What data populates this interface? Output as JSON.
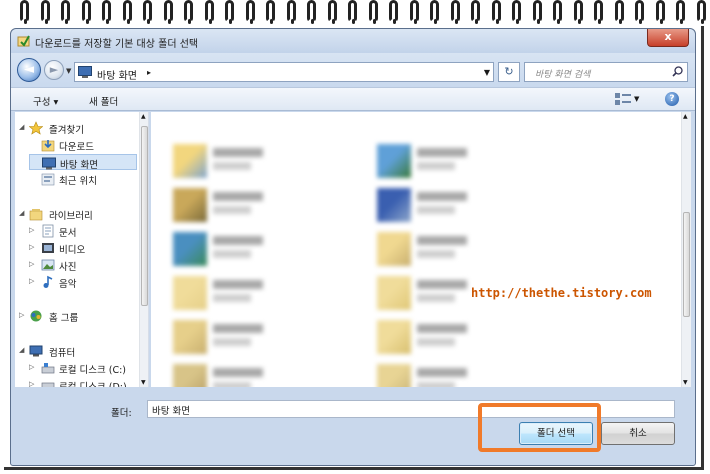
{
  "dialog": {
    "title": "다운로드를 저장할 기본 대상 폴더 선택",
    "close_label": "x"
  },
  "navbar": {
    "back_label": "◄",
    "forward_label": "►",
    "address_crumb": "바탕 화면",
    "address_arrow": "▸",
    "search_placeholder": "바탕 화면 검색"
  },
  "toolbar": {
    "organize_label": "구성 ▾",
    "new_folder_label": "새 폴더",
    "help_label": "?"
  },
  "sidebar": {
    "favorites": {
      "label": "즐겨찾기",
      "items": [
        {
          "label": "다운로드"
        },
        {
          "label": "바탕 화면"
        },
        {
          "label": "최근 위치"
        }
      ]
    },
    "libraries": {
      "label": "라이브러리",
      "items": [
        {
          "label": "문서"
        },
        {
          "label": "비디오"
        },
        {
          "label": "사진"
        },
        {
          "label": "음악"
        }
      ]
    },
    "homegroup": {
      "label": "홈 그룹"
    },
    "computer": {
      "label": "컴퓨터",
      "items": [
        {
          "label": "로컬 디스크 (C:)"
        },
        {
          "label": "로컬 디스크 (D:)"
        }
      ]
    }
  },
  "watermark": "http://thethe.tistory.com",
  "footer": {
    "folder_label": "폴더:",
    "folder_value": "바탕 화면",
    "select_button": "폴더 선택",
    "cancel_button": "취소"
  },
  "colors": {
    "highlight_border": "#f07a2a",
    "watermark_text": "#cc5500",
    "selected_nav": "#d5e5f7"
  }
}
